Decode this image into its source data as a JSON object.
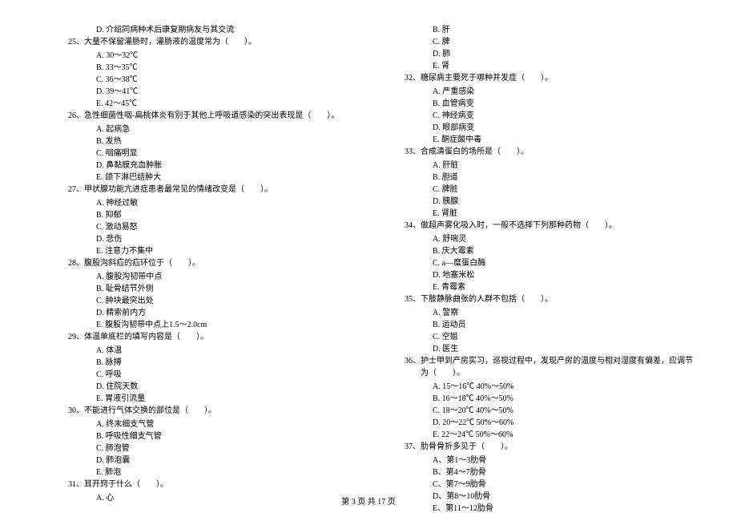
{
  "left_column": [
    {
      "type": "option",
      "text": "D. 介绍同病种术后康复期病友与其交流"
    },
    {
      "type": "question",
      "num": "25、",
      "text": "大量不保留灌肠时，灌肠液的温度常为（　　）。"
    },
    {
      "type": "option",
      "text": "A. 30～32℃"
    },
    {
      "type": "option",
      "text": "B. 33～35℃"
    },
    {
      "type": "option",
      "text": "C. 36～38℃"
    },
    {
      "type": "option",
      "text": "D. 39～41℃"
    },
    {
      "type": "option",
      "text": "E. 42～45℃"
    },
    {
      "type": "question",
      "num": "26、",
      "text": "急性细菌性咽-扁桃体炎有别于其他上呼吸道感染的突出表现是（　　）。"
    },
    {
      "type": "option",
      "text": "A. 起病急"
    },
    {
      "type": "option",
      "text": "B. 发热"
    },
    {
      "type": "option",
      "text": "C. 咽痛明显"
    },
    {
      "type": "option",
      "text": "D. 鼻黏膜充血肿胀"
    },
    {
      "type": "option",
      "text": "E. 颌下淋巴结肿大"
    },
    {
      "type": "question",
      "num": "27、",
      "text": "甲状腺功能亢进症患者最常见的情绪改变是（　　）。"
    },
    {
      "type": "option",
      "text": "A. 神经过敏"
    },
    {
      "type": "option",
      "text": "B. 抑郁"
    },
    {
      "type": "option",
      "text": "C. 激动易怒"
    },
    {
      "type": "option",
      "text": "D. 悲伤"
    },
    {
      "type": "option",
      "text": "E. 注意力不集中"
    },
    {
      "type": "question",
      "num": "28、",
      "text": "腹股沟斜疝的疝环位于（　　）。"
    },
    {
      "type": "option",
      "text": "A. 腹股沟韧带中点"
    },
    {
      "type": "option",
      "text": "B. 耻骨结节外侧"
    },
    {
      "type": "option",
      "text": "C. 肿块最突出处"
    },
    {
      "type": "option",
      "text": "D. 精索前内方"
    },
    {
      "type": "option",
      "text": "E. 腹股沟韧带中点上1.5～2.0cm"
    },
    {
      "type": "question",
      "num": "29、",
      "text": "体温单底栏的填写内容是（　　）。"
    },
    {
      "type": "option",
      "text": "A. 体温"
    },
    {
      "type": "option",
      "text": "B. 脉搏"
    },
    {
      "type": "option",
      "text": "C. 呼吸"
    },
    {
      "type": "option",
      "text": "D. 住院天数"
    },
    {
      "type": "option",
      "text": "E. 胃液引流量"
    },
    {
      "type": "question",
      "num": "30、",
      "text": "不能进行气体交换的部位是（　　）。"
    },
    {
      "type": "option",
      "text": "A. 终末细支气管"
    },
    {
      "type": "option",
      "text": "B. 呼吸性细支气管"
    },
    {
      "type": "option",
      "text": "C. 肺泡管"
    },
    {
      "type": "option",
      "text": "D. 肺泡囊"
    },
    {
      "type": "option",
      "text": "E. 肺泡"
    },
    {
      "type": "question",
      "num": "31、",
      "text": "耳开窍于什么（　　）。"
    },
    {
      "type": "option",
      "text": "A. 心"
    }
  ],
  "right_column": [
    {
      "type": "option",
      "text": "B. 肝"
    },
    {
      "type": "option",
      "text": "C. 脾"
    },
    {
      "type": "option",
      "text": "D. 肺"
    },
    {
      "type": "option",
      "text": "E. 肾"
    },
    {
      "type": "question",
      "num": "32、",
      "text": "糖尿病主要死于哪种并发症（　　）。"
    },
    {
      "type": "option",
      "text": "A. 严重感染"
    },
    {
      "type": "option",
      "text": "B. 血管病变"
    },
    {
      "type": "option",
      "text": "C. 神经病变"
    },
    {
      "type": "option",
      "text": "D. 眼部病变"
    },
    {
      "type": "option",
      "text": "E. 酮症酸中毒"
    },
    {
      "type": "question",
      "num": "33、",
      "text": "合成清蛋白的场所是（　　）。"
    },
    {
      "type": "option",
      "text": "A. 肝脏"
    },
    {
      "type": "option",
      "text": "B. 胆道"
    },
    {
      "type": "option",
      "text": "C. 脾脏"
    },
    {
      "type": "option",
      "text": "D. 胰腺"
    },
    {
      "type": "option",
      "text": "E. 肾脏"
    },
    {
      "type": "question",
      "num": "34、",
      "text": "做超声雾化吸入时，一般不选择下列那种药物（　　）。"
    },
    {
      "type": "option",
      "text": "A. 舒喘灵"
    },
    {
      "type": "option",
      "text": "B. 庆大霉素"
    },
    {
      "type": "option",
      "text": "C. a—糜蛋白酶"
    },
    {
      "type": "option",
      "text": "D. 地塞米松"
    },
    {
      "type": "option",
      "text": "E. 青霉素"
    },
    {
      "type": "question",
      "num": "35、",
      "text": "下肢静脉曲张的人群不包括（　　）。"
    },
    {
      "type": "option",
      "text": "A. 警察"
    },
    {
      "type": "option",
      "text": "B. 运动员"
    },
    {
      "type": "option",
      "text": "C. 空姐"
    },
    {
      "type": "option",
      "text": "D. 医生"
    },
    {
      "type": "question",
      "num": "36、",
      "text": "护士甲到产房实习，巡视过程中，发现产房的温度与相对湿度有偏差，应调节为（　　）。"
    },
    {
      "type": "option",
      "text": "A. 15～16℃ 40%～50%"
    },
    {
      "type": "option",
      "text": "B. 16～18℃ 40%～50%"
    },
    {
      "type": "option",
      "text": "C. 18～20℃ 40%～50%"
    },
    {
      "type": "option",
      "text": "D. 20～22℃ 50%～60%"
    },
    {
      "type": "option",
      "text": "E. 22～24℃ 50%～60%"
    },
    {
      "type": "question",
      "num": "37、",
      "text": "肋骨骨折多见于（　　）。"
    },
    {
      "type": "option",
      "text": "A、第1～3肋骨"
    },
    {
      "type": "option",
      "text": "B、第4～7肋骨"
    },
    {
      "type": "option",
      "text": "C、第7～9肋骨"
    },
    {
      "type": "option",
      "text": "D、第8～10肋骨"
    },
    {
      "type": "option",
      "text": "E、第11～12肋骨"
    }
  ],
  "footer": "第 3 页 共 17 页"
}
